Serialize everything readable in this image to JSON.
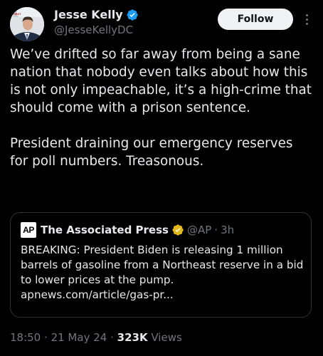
{
  "author": {
    "name": "Jesse Kelly",
    "handle": "@JesseKellyDC",
    "avatar_badge": "FIRST",
    "verified_color": "#1d9bf0"
  },
  "follow_label": "Follow",
  "more_icon": "more-vertical-icon",
  "tweet": {
    "paragraph1": "We’ve drifted so far away from being a sane nation that nobody even talks about how this is not only impeachable, it’s a high-crime that should come with a prison sentence.",
    "paragraph2": "President draining our emergency reserves for poll numbers. Treasonous."
  },
  "quote": {
    "logo_text": "AP",
    "name": "The Associated Press",
    "verified_color": "#e2b719",
    "handle": "@AP",
    "separator": "·",
    "time": "3h",
    "text": "BREAKING: President Biden is releasing 1 million barrels of gasoline from a Northeast reserve in a bid to lower prices at the pump.",
    "link": "apnews.com/article/gas-pr..."
  },
  "meta": {
    "time": "18:50",
    "sep1": "·",
    "date": "21 May 24",
    "sep2": "·",
    "views_count": "323K",
    "views_label": "Views"
  }
}
